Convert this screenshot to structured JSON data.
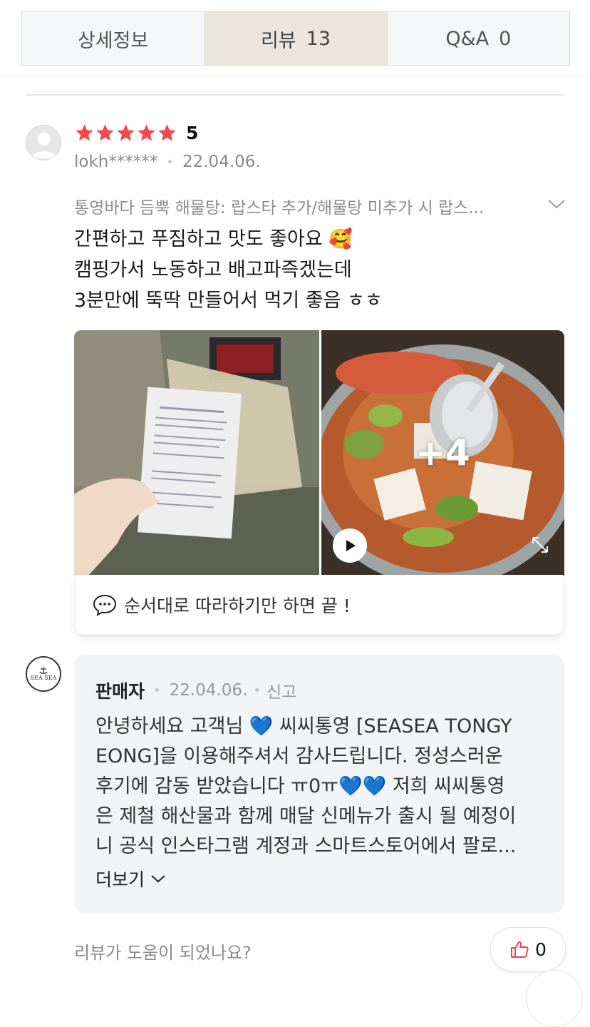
{
  "tabs": [
    {
      "label": "상세정보",
      "count": ""
    },
    {
      "label": "리뷰",
      "count": "13"
    },
    {
      "label": "Q&A",
      "count": "0"
    }
  ],
  "review": {
    "rating": "5",
    "rating_value": 5,
    "user": "lokh******",
    "date": "22.04.06.",
    "option": "통영바다 듬뿍 해물탕: 랍스타 추가/해물탕 미추가 시 랍스...",
    "lines": [
      "간편하고 푸짐하고 맛도 좋아요 🥰",
      "캠핑가서 노동하고 배고파즉겠는데",
      "3분만에 뚝딱 만들어서 먹기 좋음 ㅎㅎ"
    ],
    "more_photos": "+4",
    "caption": "순서대로 따라하기만 하면 끝 !"
  },
  "seller": {
    "logo_text": "SEA SEA",
    "name": "판매자",
    "date": "22.04.06.",
    "report": "신고",
    "lines": [
      "안녕하세요 고객님 💙 씨씨통영 [SEASEA TONGY",
      "EONG]을 이용해주셔서 감사드립니다. 정성스러운",
      "후기에 감동 받았습니다 ㅠ0ㅠ💙💙 저희 씨씨통영",
      "은 제철 해산물과 함께 매달 신메뉴가 출시 될 예정이",
      "니 공식 인스타그램 계정과 스마트스토어에서 팔로..."
    ],
    "more": "더보기"
  },
  "footer": {
    "helpful_question": "리뷰가 도움이 되었나요?",
    "like_count": "0"
  },
  "colors": {
    "star": "#f5484b",
    "active_tab": "#ebe5de",
    "seller_box": "#f3f4f6",
    "like_icon": "#e8484b"
  }
}
